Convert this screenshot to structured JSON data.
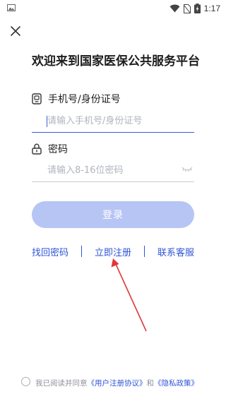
{
  "status_bar": {
    "time": "1:17"
  },
  "title": "欢迎来到国家医保公共服务平台",
  "phone_field": {
    "label": "手机号/身份证号",
    "value": "",
    "placeholder": "请输入手机号/身份证号"
  },
  "password_field": {
    "label": "密码",
    "value": "",
    "placeholder": "请输入8-16位密码"
  },
  "login_button": {
    "label": "登录"
  },
  "links": {
    "retrieve_password": "找回密码",
    "register": "立即注册",
    "customer_service": "联系客服"
  },
  "agreement": {
    "prefix": "我已阅读并同意",
    "user_agreement": "《用户注册协议》",
    "and": "和",
    "privacy_policy": "《隐私政策》"
  },
  "colors": {
    "accent": "#2f55d4",
    "login_button_disabled": "#b7c5f4",
    "arrow": "#e0373a"
  }
}
